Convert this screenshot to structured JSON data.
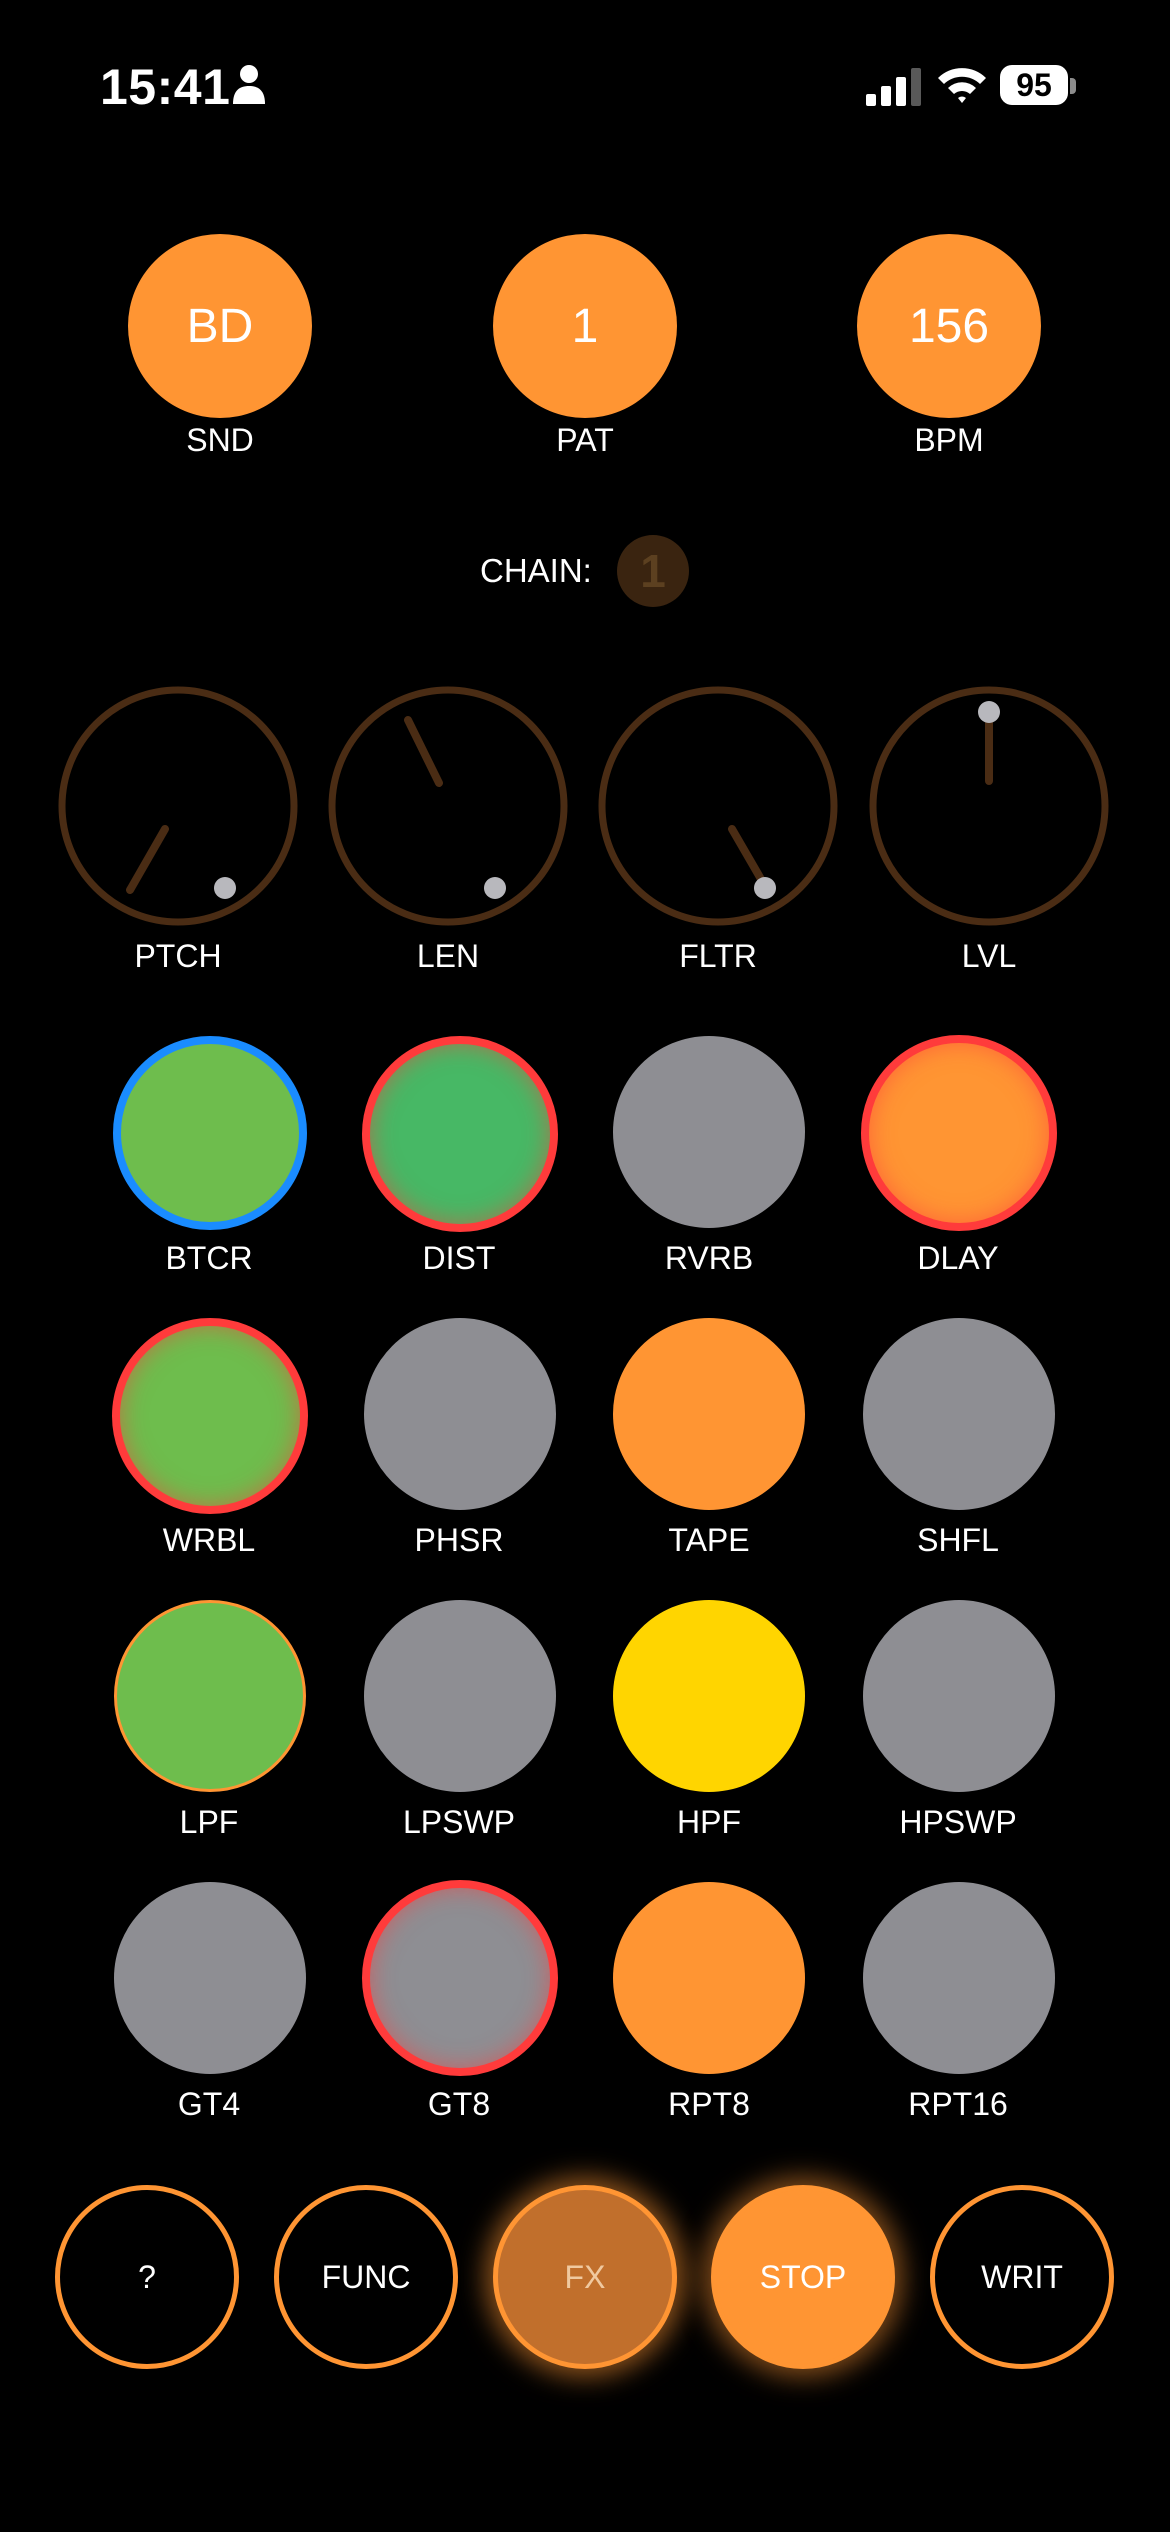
{
  "status_bar": {
    "time": "15:41",
    "battery": "95"
  },
  "header": {
    "snd": {
      "value": "BD",
      "label": "SND"
    },
    "pat": {
      "value": "1",
      "label": "PAT"
    },
    "bpm": {
      "value": "156",
      "label": "BPM"
    }
  },
  "chain": {
    "label": "CHAIN:",
    "value": "1"
  },
  "knobs": [
    {
      "label": "PTCH"
    },
    {
      "label": "LEN"
    },
    {
      "label": "FLTR"
    },
    {
      "label": "LVL"
    }
  ],
  "pads": [
    {
      "label": "BTCR"
    },
    {
      "label": "DIST"
    },
    {
      "label": "RVRB"
    },
    {
      "label": "DLAY"
    },
    {
      "label": "WRBL"
    },
    {
      "label": "PHSR"
    },
    {
      "label": "TAPE"
    },
    {
      "label": "SHFL"
    },
    {
      "label": "LPF"
    },
    {
      "label": "LPSWP"
    },
    {
      "label": "HPF"
    },
    {
      "label": "HPSWP"
    },
    {
      "label": "GT4"
    },
    {
      "label": "GT8"
    },
    {
      "label": "RPT8"
    },
    {
      "label": "RPT16"
    }
  ],
  "bottom_buttons": [
    {
      "label": "?"
    },
    {
      "label": "FUNC"
    },
    {
      "label": "FX"
    },
    {
      "label": "STOP"
    },
    {
      "label": "WRIT"
    }
  ],
  "colors": {
    "accent_orange": "#ff9533",
    "active_red": "#ff3b3b",
    "active_blue": "#1a8cff",
    "pad_grey": "#8e8e93",
    "pad_green": "#6ebd4d",
    "pad_yellow": "#ffd500",
    "knob_brown": "#4a2c14"
  }
}
